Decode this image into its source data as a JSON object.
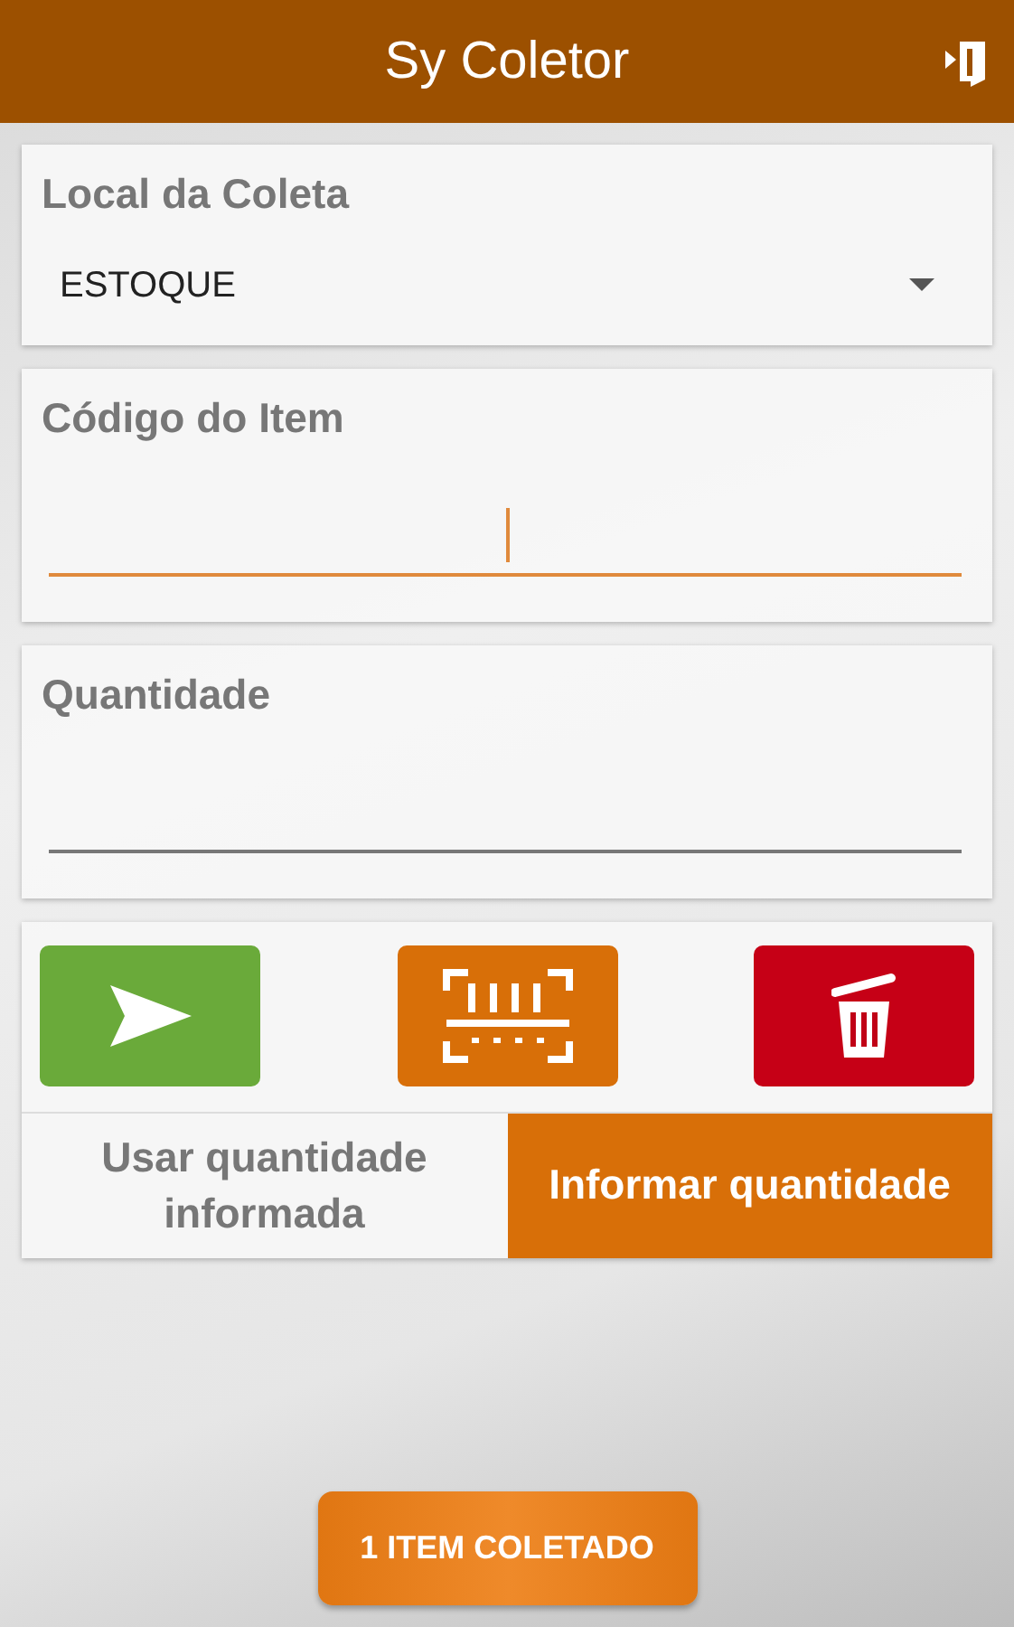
{
  "app_bar": {
    "title": "Sy Coletor"
  },
  "location": {
    "label": "Local da Coleta",
    "value": "ESTOQUE"
  },
  "fields": [
    {
      "label": "Código do Item",
      "focused": true
    },
    {
      "label": "Quantidade",
      "focused": false
    }
  ],
  "actions": [
    {
      "kind": "send"
    },
    {
      "kind": "scan"
    },
    {
      "kind": "delete"
    }
  ],
  "quantity_mode": [
    {
      "label": "Usar quantidade informada",
      "selected": false
    },
    {
      "label": "Informar quantidade",
      "selected": true
    }
  ],
  "collected_button": "1 ITEM COLETADO"
}
